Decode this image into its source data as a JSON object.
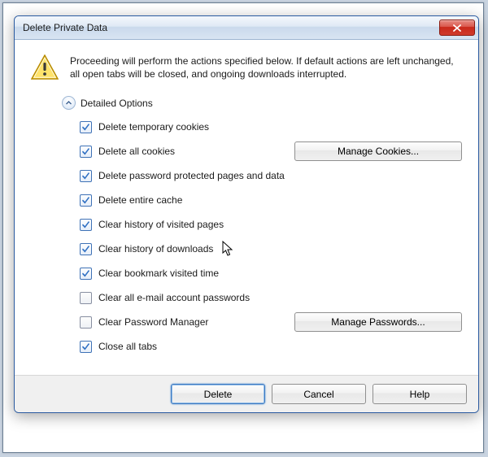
{
  "title": "Delete Private Data",
  "warning": "Proceeding will perform the actions specified below. If default actions are left unchanged, all open tabs will be closed, and ongoing downloads interrupted.",
  "detailed_label": "Detailed Options",
  "options": [
    {
      "label": "Delete temporary cookies",
      "checked": true
    },
    {
      "label": "Delete all cookies",
      "checked": true,
      "button": "Manage Cookies..."
    },
    {
      "label": "Delete password protected pages and data",
      "checked": true
    },
    {
      "label": "Delete entire cache",
      "checked": true
    },
    {
      "label": "Clear history of visited pages",
      "checked": true
    },
    {
      "label": "Clear history of downloads",
      "checked": true
    },
    {
      "label": "Clear bookmark visited time",
      "checked": true
    },
    {
      "label": "Clear all e-mail account passwords",
      "checked": false
    },
    {
      "label": "Clear Password Manager",
      "checked": false,
      "button": "Manage Passwords..."
    },
    {
      "label": "Close all tabs",
      "checked": true
    }
  ],
  "buttons": {
    "delete": "Delete",
    "cancel": "Cancel",
    "help": "Help"
  }
}
